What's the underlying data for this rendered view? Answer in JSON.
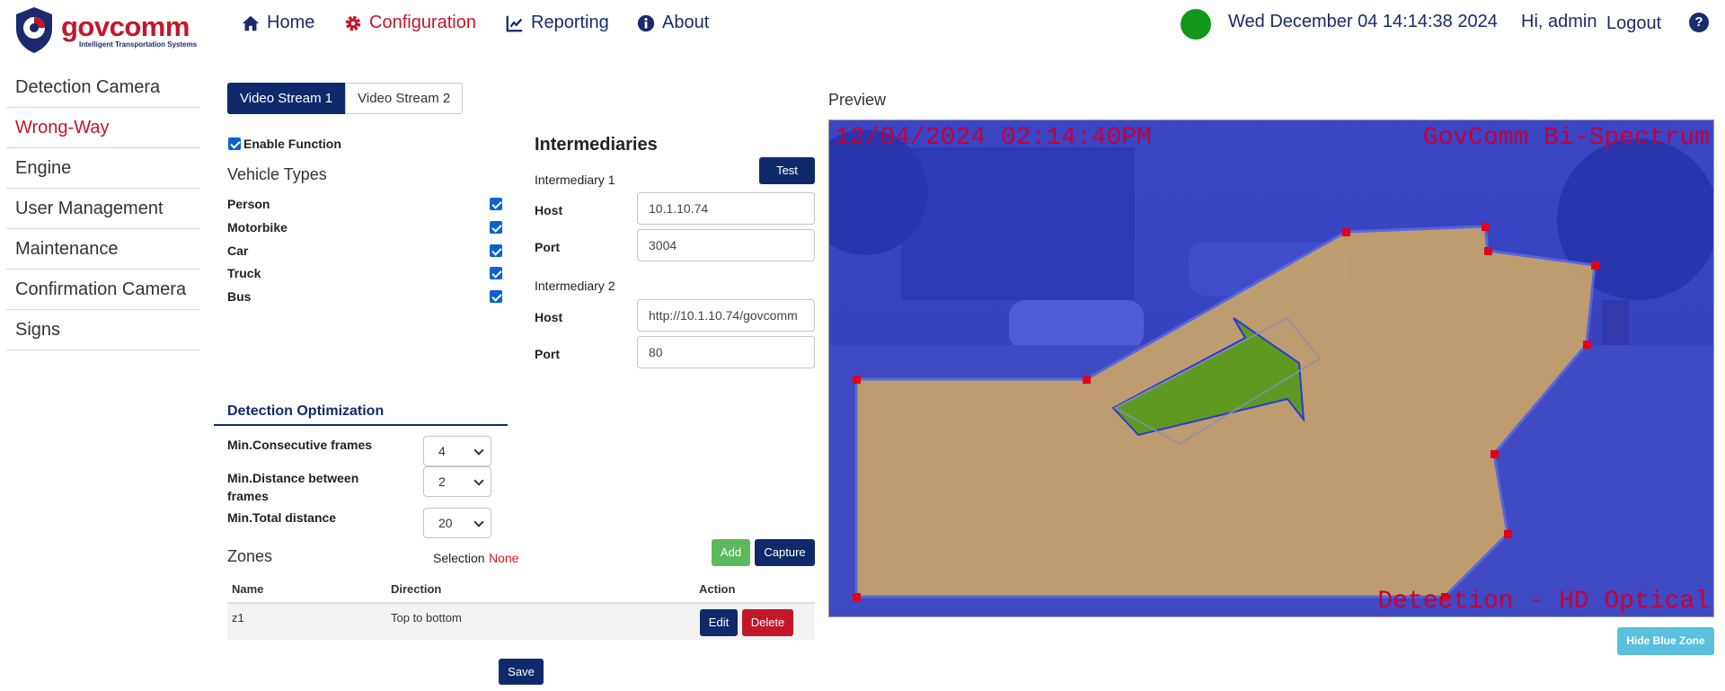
{
  "header": {
    "brand": "govcomm",
    "tagline": "Intelligent Transportation Systems",
    "nav": [
      {
        "label": "Home"
      },
      {
        "label": "Configuration"
      },
      {
        "label": "Reporting"
      },
      {
        "label": "About"
      }
    ],
    "datetime": "Wed December 04 14:14:38 2024",
    "greeting": "Hi, admin",
    "logout": "Logout",
    "help_glyph": "?",
    "status_color": "#109618"
  },
  "sidebar": {
    "items": [
      {
        "label": "Detection Camera"
      },
      {
        "label": "Wrong-Way"
      },
      {
        "label": "Engine"
      },
      {
        "label": "User Management"
      },
      {
        "label": "Maintenance"
      },
      {
        "label": "Confirmation Camera"
      },
      {
        "label": "Signs"
      }
    ]
  },
  "streams": {
    "tabs": [
      {
        "label": "Video Stream 1"
      },
      {
        "label": "Video Stream 2"
      }
    ]
  },
  "function": {
    "enable_label": "Enable Function",
    "enabled": true
  },
  "vehicle_types": {
    "title": "Vehicle Types",
    "items": [
      {
        "label": "Person",
        "checked": true
      },
      {
        "label": "Motorbike",
        "checked": true
      },
      {
        "label": "Car",
        "checked": true
      },
      {
        "label": "Truck",
        "checked": true
      },
      {
        "label": "Bus",
        "checked": true
      }
    ]
  },
  "intermediaries": {
    "title": "Intermediaries",
    "test_label": "Test",
    "host_label": "Host",
    "port_label": "Port",
    "items": [
      {
        "title": "Intermediary 1",
        "host": "10.1.10.74",
        "port": "3004"
      },
      {
        "title": "Intermediary 2",
        "host": "http://10.1.10.74/govcomm",
        "port": "80"
      }
    ]
  },
  "optimization": {
    "title": "Detection Optimization",
    "fields": [
      {
        "label": "Min.Consecutive frames",
        "value": "4"
      },
      {
        "label": "Min.Distance between frames",
        "value": "2"
      },
      {
        "label": "Min.Total distance",
        "value": "20"
      }
    ]
  },
  "zones": {
    "title": "Zones",
    "selection_label": "Selection",
    "selection_value": "None",
    "add_label": "Add",
    "capture_label": "Capture",
    "columns": [
      "Name",
      "Direction",
      "Action"
    ],
    "rows": [
      {
        "name": "z1",
        "direction": "Top to bottom"
      }
    ],
    "edit_label": "Edit",
    "delete_label": "Delete"
  },
  "save_label": "Save",
  "preview": {
    "title": "Preview",
    "overlay_date": "12/04/2024 02:14:40PM",
    "overlay_brand": "GovComm Bi-Spectrum",
    "overlay_mode": "Detection - HD Optical",
    "hide_zone_label": "Hide Blue Zone"
  }
}
